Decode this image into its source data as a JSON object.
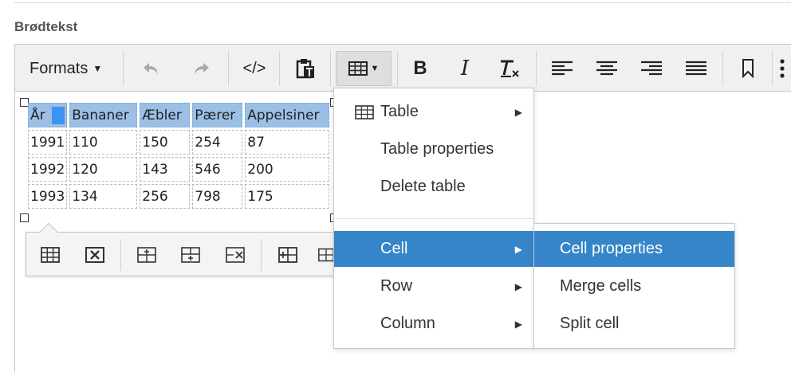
{
  "field_label": "Brødtekst",
  "toolbar": {
    "formats_label": "Formats",
    "code_label": "</>",
    "bold_label": "B",
    "italic_label": "I"
  },
  "table": {
    "header": [
      "År",
      "Bananer",
      "Æbler",
      "Pærer",
      "Appelsiner"
    ],
    "rows": [
      [
        "1991",
        "110",
        "150",
        "254",
        "87"
      ],
      [
        "1992",
        "120",
        "143",
        "546",
        "200"
      ],
      [
        "1993",
        "134",
        "256",
        "798",
        "175"
      ]
    ]
  },
  "table_menu": {
    "items": [
      "Table",
      "Table properties",
      "Delete table",
      "Cell",
      "Row",
      "Column"
    ]
  },
  "cell_submenu": {
    "items": [
      "Cell properties",
      "Merge cells",
      "Split cell"
    ]
  },
  "colors": {
    "menu_selected": "#3585c8",
    "header_cell": "#9cbfe6",
    "caret": "#3d93f2"
  }
}
